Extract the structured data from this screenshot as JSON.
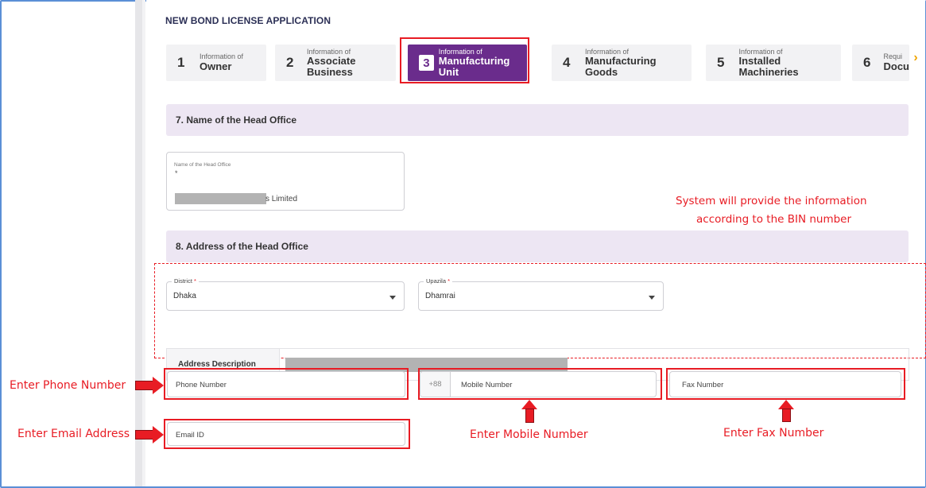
{
  "app": {
    "title": "NEW BOND LICENSE APPLICATION"
  },
  "steps": [
    {
      "number": "1",
      "sub": "Information of",
      "label": "Owner"
    },
    {
      "number": "2",
      "sub": "Information of",
      "label": "Associate Business"
    },
    {
      "number": "3",
      "sub": "Information of",
      "label": "Manufacturing Unit"
    },
    {
      "number": "4",
      "sub": "Information of",
      "label": "Manufacturing Goods"
    },
    {
      "number": "5",
      "sub": "Information of",
      "label": "Installed Machineries"
    },
    {
      "number": "6",
      "sub": "Requi",
      "label": "Docu"
    }
  ],
  "active_step": "3",
  "section7": {
    "title": "7. Name of the Head Office",
    "field_label": "Name of the Head Office",
    "required_mark": "*",
    "value_suffix": "s Limited"
  },
  "section8": {
    "title": "8. Address of the Head Office",
    "district": {
      "label": "District",
      "required_mark": "*",
      "value": "Dhaka"
    },
    "upazila": {
      "label": "Upazila",
      "required_mark": "*",
      "value": "Dhamrai"
    },
    "address_label": "Address Description"
  },
  "contact": {
    "phone_placeholder": "Phone Number",
    "mobile_prefix": "+88",
    "mobile_placeholder": "Mobile Number",
    "fax_placeholder": "Fax Number",
    "email_placeholder": "Email ID"
  },
  "annotations": {
    "system_note_line1": "System will provide the information",
    "system_note_line2": "according to the BIN number",
    "enter_phone": "Enter Phone Number",
    "enter_email": "Enter Email Address",
    "enter_mobile": "Enter Mobile Number",
    "enter_fax": "Enter Fax Number"
  },
  "colors": {
    "accent": "#6a2c8c",
    "highlight": "#e81c24",
    "section_bg": "#ede6f3",
    "scroll_arrow": "#f0a500"
  },
  "icons": {
    "dropdown": "chevron-down-icon",
    "steps_next": "chevron-right-icon"
  }
}
